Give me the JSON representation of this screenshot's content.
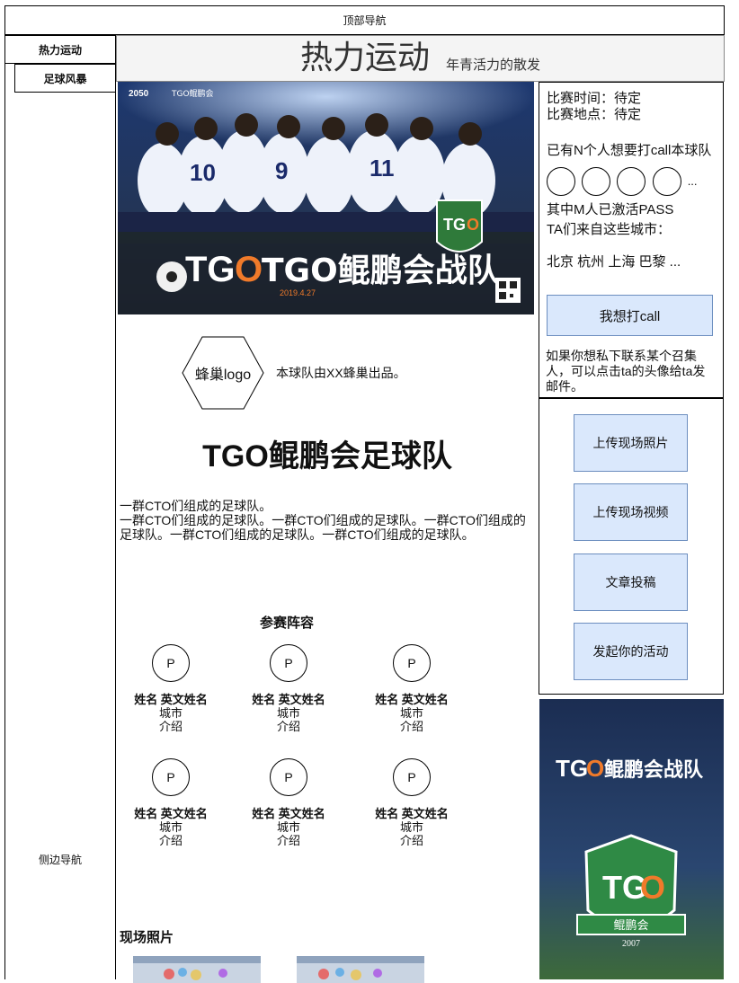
{
  "top_nav": {
    "label": "顶部导航"
  },
  "sidebar": {
    "items": [
      {
        "label": "热力运动"
      },
      {
        "label": "足球风暴"
      }
    ],
    "label": "侧边导航"
  },
  "header": {
    "title": "热力运动",
    "subtitle": "年青活力的散发"
  },
  "banner": {
    "brand": "TGO鲲鹏会",
    "title": "TGO鲲鹏会战队",
    "date_text": "2019.4.27",
    "event_code": "2050"
  },
  "info": {
    "time": "比赛时间：待定",
    "place": "比赛地点：待定",
    "call_count_text": "已有N个人想要打call本球队",
    "more": "...",
    "pass_text": "其中M人已激活PASS",
    "cities_label": "TA们来自这些城市：",
    "cities": "北京 杭州 上海 巴黎 ...",
    "call_button": "我想打call",
    "note": "如果你想私下联系某个召集人，可以点击ta的头像给ta发邮件。"
  },
  "actions": [
    {
      "label": "上传现场照片"
    },
    {
      "label": "上传现场视频"
    },
    {
      "label": "文章投稿"
    },
    {
      "label": "发起你的活动"
    }
  ],
  "logo": {
    "label": "蜂巢logo",
    "desc": "本球队由XX蜂巢出品。"
  },
  "team": {
    "title": "TGO鲲鹏会足球队",
    "intro_line1": "一群CTO们组成的足球队。",
    "intro_line2": "一群CTO们组成的足球队。一群CTO们组成的足球队。一群CTO们组成的足球队。一群CTO们组成的足球队。一群CTO们组成的足球队。"
  },
  "roster": {
    "title": "参赛阵容",
    "players": [
      {
        "avatar": "P",
        "name": "姓名 英文姓名",
        "city": "城市",
        "intro": "介绍"
      },
      {
        "avatar": "P",
        "name": "姓名 英文姓名",
        "city": "城市",
        "intro": "介绍"
      },
      {
        "avatar": "P",
        "name": "姓名 英文姓名",
        "city": "城市",
        "intro": "介绍"
      },
      {
        "avatar": "P",
        "name": "姓名 英文姓名",
        "city": "城市",
        "intro": "介绍"
      },
      {
        "avatar": "P",
        "name": "姓名 英文姓名",
        "city": "城市",
        "intro": "介绍"
      },
      {
        "avatar": "P",
        "name": "姓名 英文姓名",
        "city": "城市",
        "intro": "介绍"
      }
    ]
  },
  "photos": {
    "title": "现场照片"
  },
  "poster": {
    "title": "TGO鲲鹏会战队",
    "badge": "TGO",
    "badge_sub": "鲲鹏会",
    "year": "2007"
  }
}
